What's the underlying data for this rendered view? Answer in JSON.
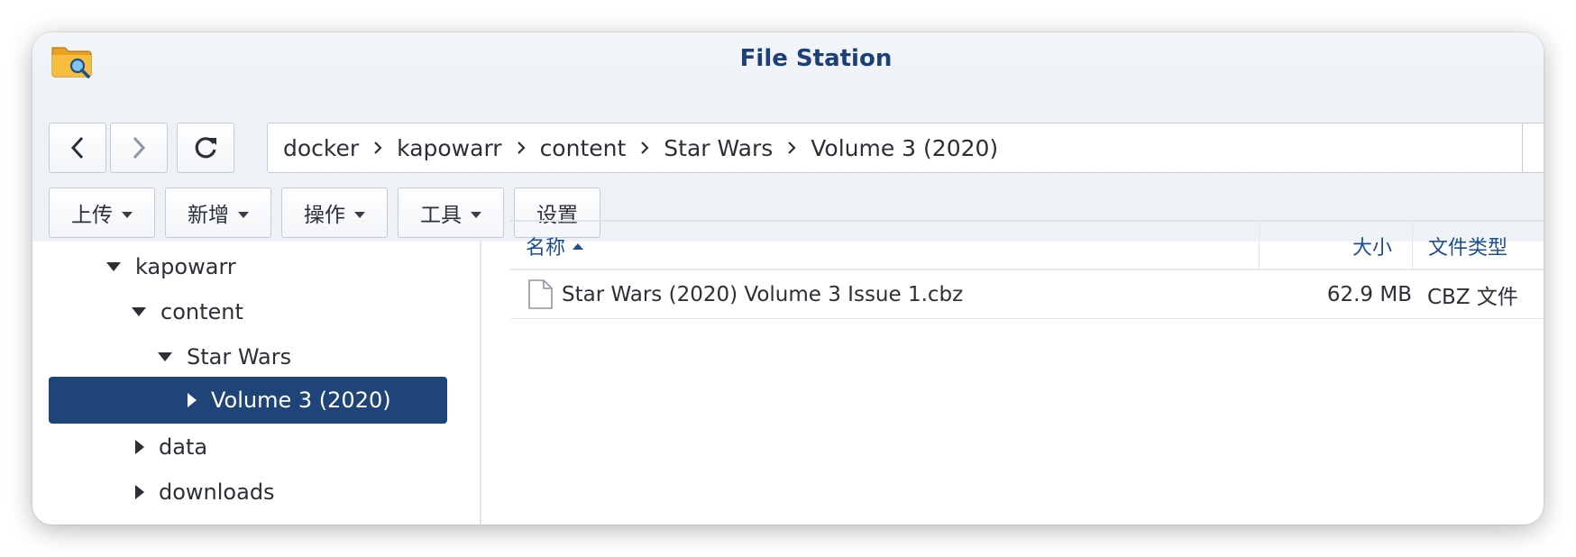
{
  "window": {
    "title": "File Station",
    "icon": "file-station-folder-icon"
  },
  "nav": {
    "back_icon": "chevron-left-icon",
    "forward_icon": "chevron-right-icon",
    "refresh_icon": "refresh-icon",
    "breadcrumbs": [
      "docker",
      "kapowarr",
      "content",
      "Star Wars",
      "Volume 3 (2020)"
    ],
    "favorite_icon": "star-icon"
  },
  "toolbar": {
    "upload": "上传",
    "create": "新增",
    "action": "操作",
    "tools": "工具",
    "settings": "设置"
  },
  "tree": {
    "items": [
      {
        "label": "kapowarr",
        "expanded": true
      },
      {
        "label": "content",
        "expanded": true
      },
      {
        "label": "Star Wars",
        "expanded": true
      },
      {
        "label": "Volume 3 (2020)",
        "expanded": false,
        "selected": true
      },
      {
        "label": "data",
        "expanded": false
      },
      {
        "label": "downloads",
        "expanded": false
      }
    ]
  },
  "filelist": {
    "columns": {
      "name": "名称",
      "size": "大小",
      "type": "文件类型"
    },
    "sort": "name-ascending",
    "rows": [
      {
        "name": "Star Wars (2020) Volume 3 Issue 1.cbz",
        "size": "62.9 MB",
        "type": "CBZ 文件",
        "icon": "file-icon"
      }
    ]
  },
  "colors": {
    "accent": "#1f4478",
    "title": "#1d3f78",
    "header_text": "#1d4d93"
  }
}
